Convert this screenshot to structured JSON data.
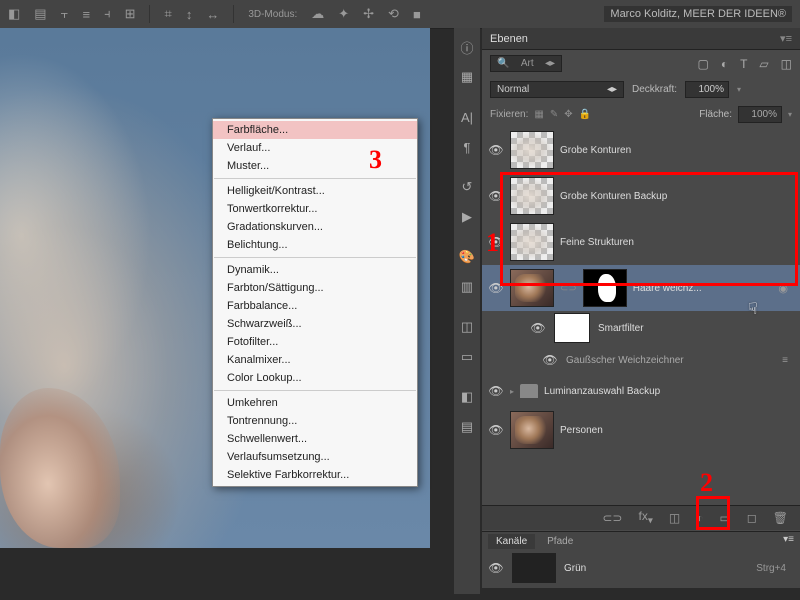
{
  "topbar": {
    "mode_label": "3D-Modus:",
    "doc_title": "Marco Kolditz, MEER DER IDEEN®"
  },
  "context_menu": {
    "items": [
      {
        "label": "Farbfläche...",
        "hi": true
      },
      {
        "label": "Verlauf..."
      },
      {
        "label": "Muster..."
      },
      {
        "sep": true
      },
      {
        "label": "Helligkeit/Kontrast..."
      },
      {
        "label": "Tonwertkorrektur..."
      },
      {
        "label": "Gradationskurven..."
      },
      {
        "label": "Belichtung..."
      },
      {
        "sep": true
      },
      {
        "label": "Dynamik..."
      },
      {
        "label": "Farbton/Sättigung..."
      },
      {
        "label": "Farbbalance..."
      },
      {
        "label": "Schwarzweiß..."
      },
      {
        "label": "Fotofilter..."
      },
      {
        "label": "Kanalmixer..."
      },
      {
        "label": "Color Lookup..."
      },
      {
        "sep": true
      },
      {
        "label": "Umkehren"
      },
      {
        "label": "Tontrennung..."
      },
      {
        "label": "Schwellenwert..."
      },
      {
        "label": "Verlaufsumsetzung..."
      },
      {
        "label": "Selektive Farbkorrektur..."
      }
    ]
  },
  "annotations": {
    "one": "1",
    "two": "2",
    "three": "3"
  },
  "panel": {
    "title": "Ebenen",
    "search": "Art",
    "blend_mode": "Normal",
    "opacity_label": "Deckkraft:",
    "opacity": "100%",
    "fill_label": "Fläche:",
    "fill": "100%",
    "lock_label": "Fixieren:"
  },
  "layers": [
    {
      "name": "Grobe Konturen",
      "thumb": "checker"
    },
    {
      "name": "Grobe Konturen Backup",
      "thumb": "checker"
    },
    {
      "name": "Feine Strukturen",
      "thumb": "checker"
    },
    {
      "name": "Haare weichz...",
      "thumb": "photo",
      "mask": true,
      "sel": true
    },
    {
      "name": "Smartfilter",
      "thumb": "white",
      "filter": true
    },
    {
      "name": "Gaußscher Weichzeichner",
      "sub": true
    },
    {
      "name": "Luminanzauswahl Backup",
      "folder": true
    },
    {
      "name": "Personen",
      "thumb": "photo"
    }
  ],
  "channels": {
    "tab1": "Kanäle",
    "tab2": "Pfade",
    "name": "Grün",
    "shortcut": "Strg+4"
  }
}
